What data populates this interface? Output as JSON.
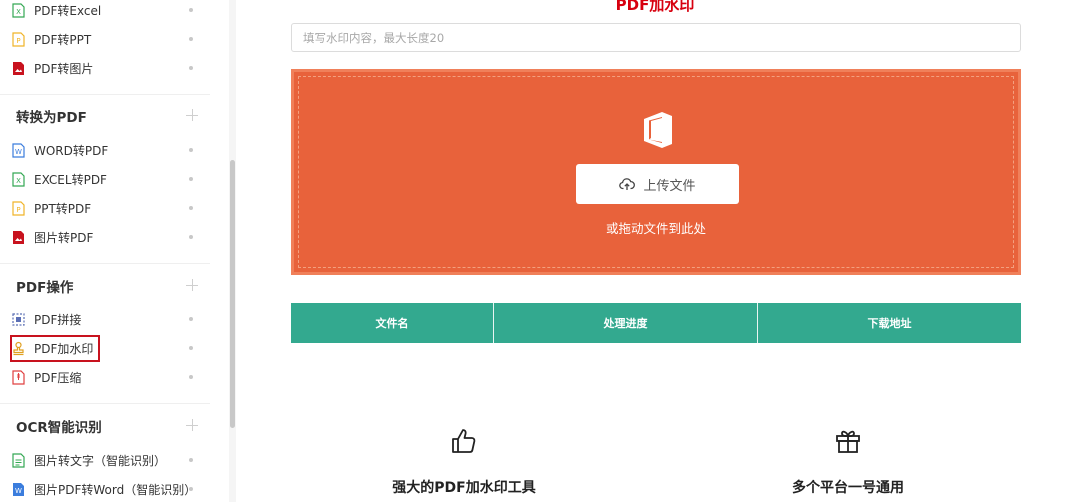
{
  "sidebar": {
    "items_top": [
      {
        "label": "PDF转Excel",
        "icon": "excel-file-icon",
        "color": "#34a853"
      },
      {
        "label": "PDF转PPT",
        "icon": "ppt-file-icon",
        "color": "#f0b429"
      },
      {
        "label": "PDF转图片",
        "icon": "image-file-icon",
        "color": "#c8121e"
      }
    ],
    "group_to_pdf": "转换为PDF",
    "items_to_pdf": [
      {
        "label": "WORD转PDF",
        "icon": "word-file-icon"
      },
      {
        "label": "EXCEL转PDF",
        "icon": "excel-file-icon"
      },
      {
        "label": "PPT转PDF",
        "icon": "ppt-file-icon"
      },
      {
        "label": "图片转PDF",
        "icon": "image-file-icon"
      }
    ],
    "group_pdf_ops": "PDF操作",
    "items_pdf_ops": [
      {
        "label": "PDF拼接",
        "icon": "merge-icon"
      },
      {
        "label": "PDF加水印",
        "icon": "stamp-icon",
        "active": true
      },
      {
        "label": "PDF压缩",
        "icon": "compress-file-icon"
      }
    ],
    "group_ocr": "OCR智能识别",
    "items_ocr": [
      {
        "label": "图片转文字（智能识别）",
        "icon": "text-file-icon"
      },
      {
        "label": "图片PDF转Word（智能识别）",
        "icon": "word-file-icon"
      }
    ]
  },
  "main": {
    "title": "PDF加水印",
    "watermark_placeholder": "填写水印内容，最大长度20",
    "upload_label": "上传文件",
    "drag_hint": "或拖动文件到此处",
    "table_headers": [
      "文件名",
      "处理进度",
      "下载地址"
    ],
    "features": [
      {
        "title": "强大的PDF加水印工具",
        "icon": "thumbs-up-icon"
      },
      {
        "title": "多个平台一号通用",
        "icon": "gift-icon"
      }
    ]
  },
  "colors": {
    "accent_red": "#d7000f",
    "dropzone": "#e8623b",
    "table_header": "#33a98f"
  }
}
